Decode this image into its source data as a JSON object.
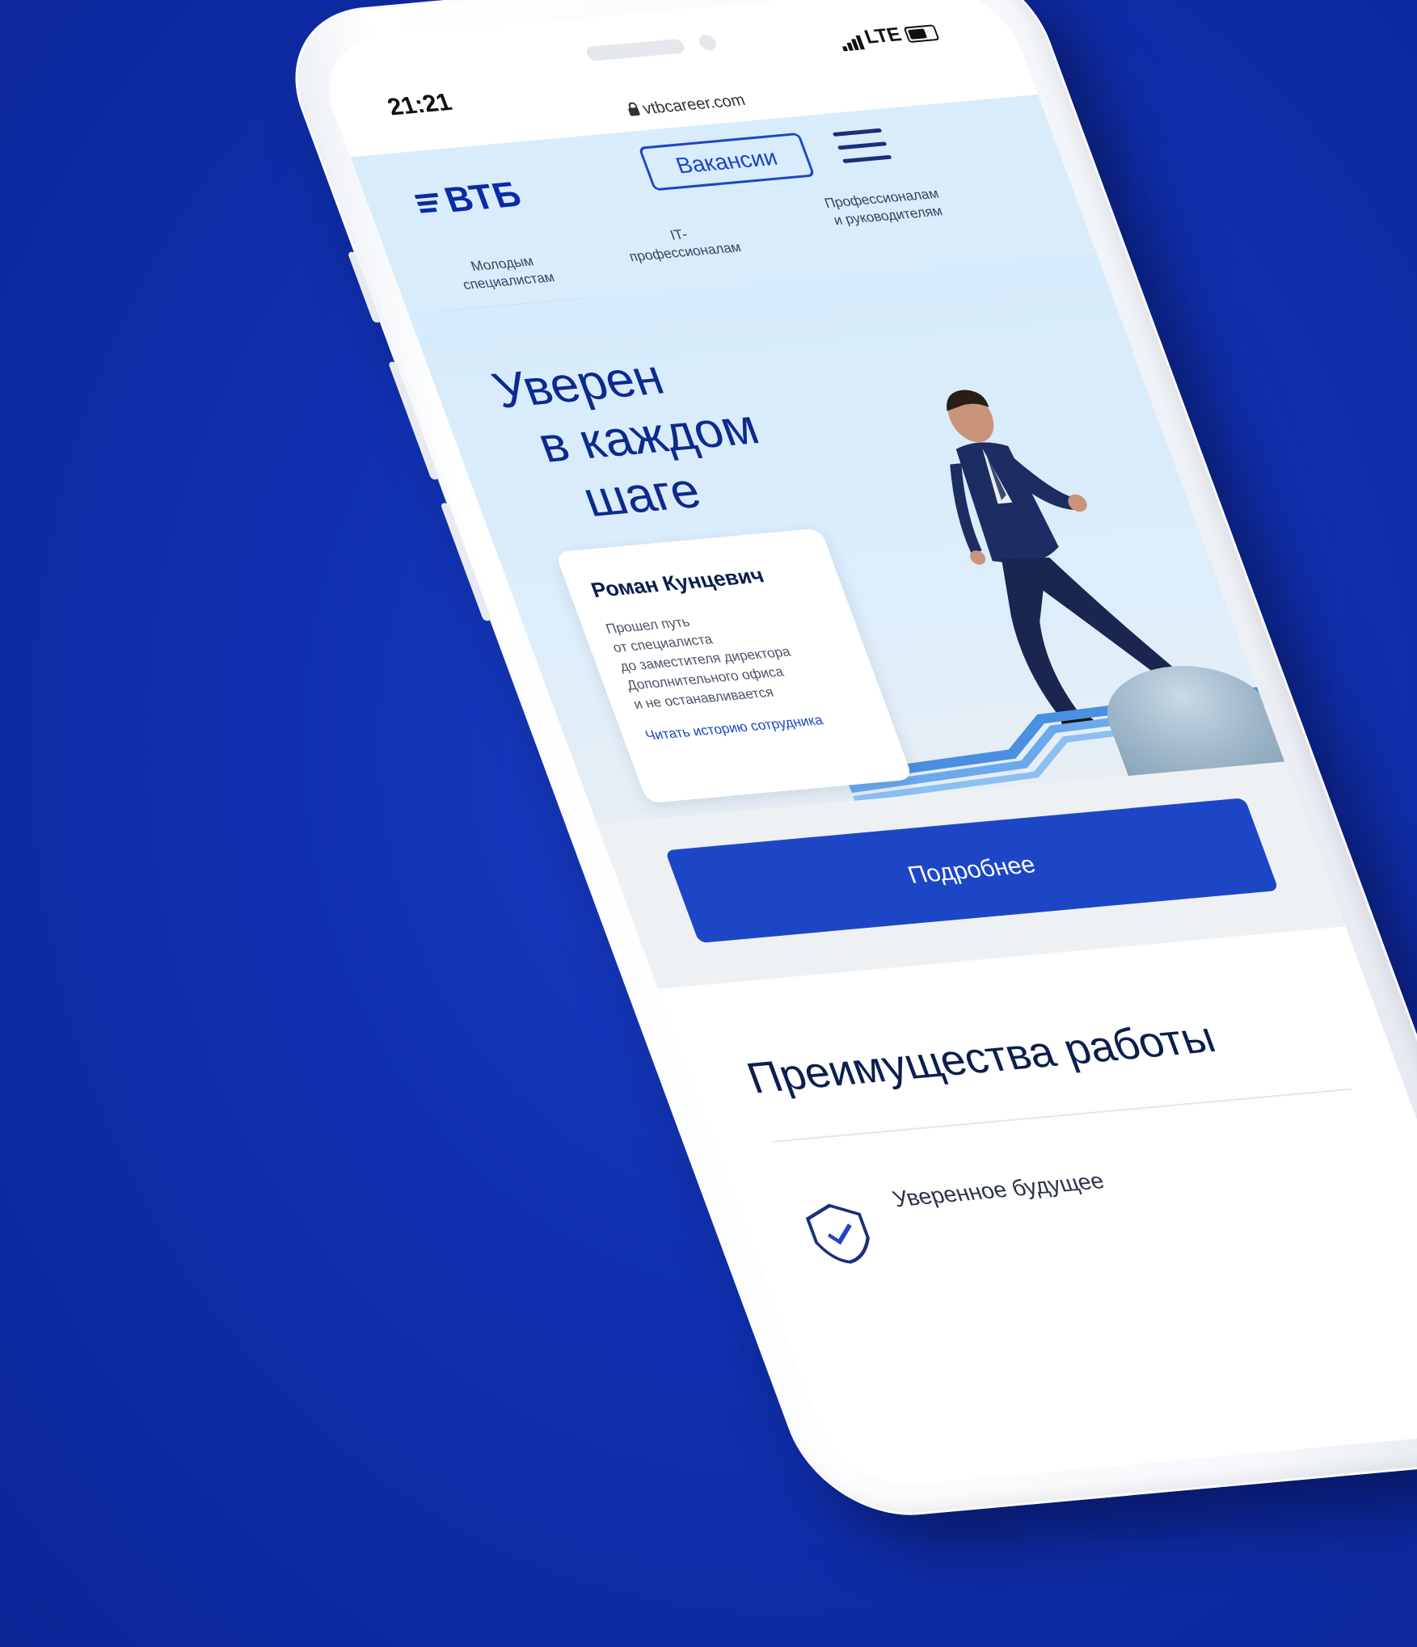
{
  "status_bar": {
    "time": "21:21",
    "network": "LTE",
    "url": "vtbcareer.com"
  },
  "header": {
    "logo_text": "ВТБ",
    "vacancies_label": "Вакансии",
    "tabs": [
      {
        "label_line1": "Молодым",
        "label_line2": "специалистам"
      },
      {
        "label_line1": "IT-",
        "label_line2": "профессионалам"
      },
      {
        "label_line1": "Профессионалам",
        "label_line2": "и руководителям"
      }
    ]
  },
  "hero": {
    "title_lines": [
      "Уверен",
      "в каждом",
      "шаге"
    ],
    "card": {
      "name": "Роман Кунцевич",
      "text_lines": [
        "Прошел путь",
        "от специалиста",
        "до заместителя директора",
        "Дополнительного офиса",
        "и не останавливается"
      ],
      "link": "Читать историю сотрудника"
    }
  },
  "more_button": "Подробнее",
  "advantages": {
    "title": "Преимущества работы",
    "items": [
      {
        "label": "Уверенное будущее",
        "icon": "shield-check-icon"
      }
    ]
  },
  "colors": {
    "background": "#1030b0",
    "brand_blue": "#1d46c7",
    "logo_blue": "#0a2aa8",
    "hero_bg": "#d8ecfb"
  }
}
